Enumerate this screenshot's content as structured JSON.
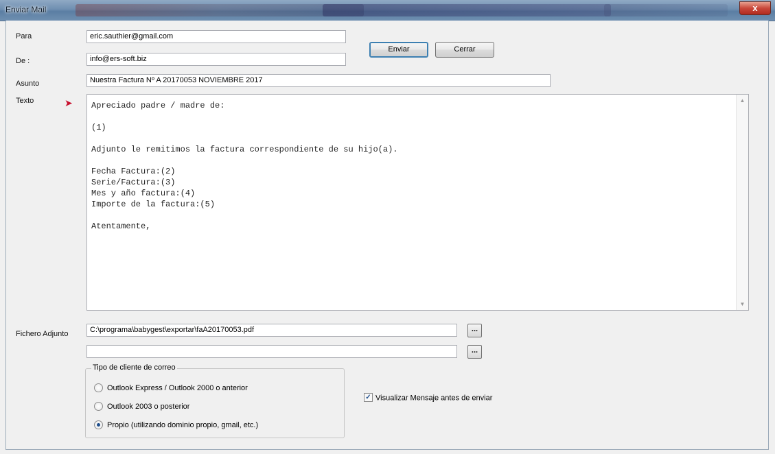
{
  "window": {
    "title": "Enviar Mail",
    "close_glyph": "x"
  },
  "form": {
    "para_label": "Para",
    "para_value": "eric.sauthier@gmail.com",
    "de_label": "De :",
    "de_value": "info@ers-soft.biz",
    "asunto_label": "Asunto",
    "asunto_value": "Nuestra Factura Nº A 20170053 NOVIEMBRE 2017",
    "texto_label": "Texto",
    "texto_value": "Apreciado padre / madre de:\n\n(1)\n\nAdjunto le remitimos la factura correspondiente de su hijo(a).\n\nFecha Factura:(2)\nSerie/Factura:(3)\nMes y año factura:(4)\nImporte de la factura:(5)\n\nAtentamente,",
    "adjunto_label": "Fichero Adjunto",
    "adjunto_value_1": "C:\\programa\\babygest\\exportar\\faA20170053.pdf",
    "adjunto_value_2": "",
    "browse_label": "..."
  },
  "buttons": {
    "enviar": "Enviar",
    "cerrar": "Cerrar"
  },
  "client_group": {
    "legend": "Tipo de cliente de correo",
    "options": [
      {
        "label": "Outlook Express / Outlook 2000 o anterior",
        "checked": false
      },
      {
        "label": "Outlook 2003 o posterior",
        "checked": false
      },
      {
        "label": "Propio (utilizando dominio propio, gmail, etc.)",
        "checked": true
      }
    ]
  },
  "preview_checkbox": {
    "label": "Visualizar Mensaje antes de enviar",
    "checked": true,
    "mark": "✓"
  },
  "scroll": {
    "up": "▲",
    "down": "▼"
  },
  "arrow_glyph": "➤"
}
